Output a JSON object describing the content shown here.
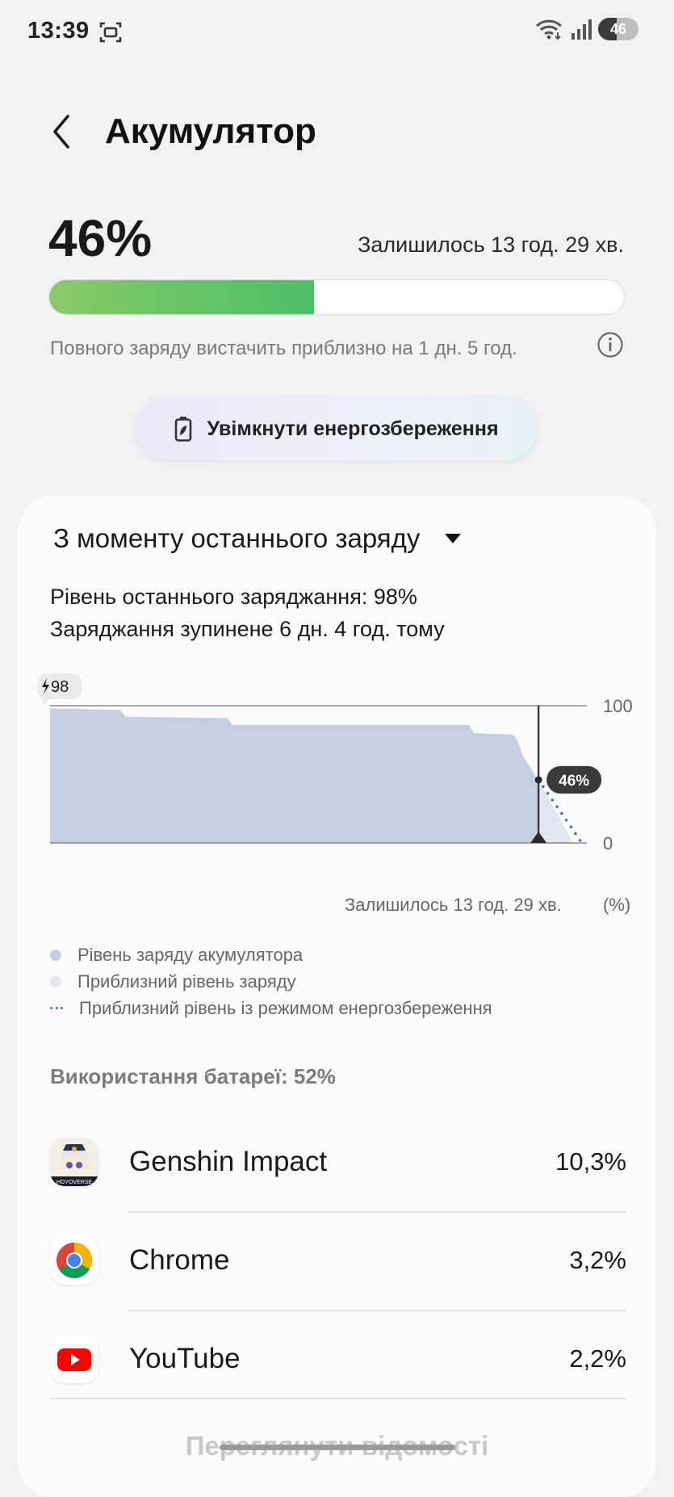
{
  "status_bar": {
    "time": "13:39",
    "battery": "46"
  },
  "header": {
    "title": "Акумулятор"
  },
  "battery": {
    "percent_label": "46%",
    "level_fraction": 0.46,
    "remaining": "Залишилось 13 год. 29 хв.",
    "full_charge_estimate": "Повного заряду вистачить приблизно на 1 дн. 5 год.",
    "fill_color": "#64c466"
  },
  "power_saving": {
    "label": "Увімкнути енергозбереження"
  },
  "usage_card": {
    "period": "З моменту останнього заряду",
    "last_charge_level": "Рівень останнього заряджання: 98%",
    "charge_stopped": "Заряджання зупинене 6 дн. 4 год. тому",
    "chart_remaining": "Залишилось 13 год. 29 хв.",
    "chart_unit": "(%)",
    "legend": [
      {
        "label": "Рівень заряду акумулятора",
        "color": "#c5cee3",
        "style": "dot"
      },
      {
        "label": "Приблизний рівень заряду",
        "color": "#e3e7f2",
        "style": "dot"
      },
      {
        "label": "Приблизний рівень із режимом енергозбереження",
        "color": "#3d6dd8",
        "style": "dotted"
      }
    ],
    "usage_heading": "Використання батареї: 52%",
    "apps": [
      {
        "name": "Genshin Impact",
        "percent": "10,3%",
        "icon": "genshin-impact-icon"
      },
      {
        "name": "Chrome",
        "percent": "3,2%",
        "icon": "chrome-icon"
      },
      {
        "name": "YouTube",
        "percent": "2,2%",
        "icon": "youtube-icon"
      }
    ],
    "view_details": "Переглянути відомості"
  },
  "chart_data": {
    "type": "area",
    "y_ticks": [
      "100",
      "0"
    ],
    "ylim": [
      0,
      100
    ],
    "start_label": "98",
    "current_label": "46%",
    "colors": {
      "actual": "#c5cee3",
      "projected": "#e3e7f2",
      "power_saving": "#3d6dd8"
    },
    "actual_x": [
      0,
      0.13,
      0.14,
      0.33,
      0.34,
      0.78,
      0.79,
      0.86,
      0.865,
      0.87,
      0.875,
      0.88,
      0.89,
      0.9,
      0.905,
      0.91
    ],
    "actual_y": [
      98,
      97,
      92,
      91,
      86,
      86,
      80,
      79,
      78,
      75,
      70,
      64,
      58,
      52,
      48,
      46
    ],
    "projected_x": [
      0.91,
      0.975
    ],
    "projected_y": [
      46,
      0
    ],
    "power_saving_x": [
      0.91,
      1.0
    ],
    "power_saving_y": [
      46,
      0
    ],
    "now_x": 0.91
  }
}
